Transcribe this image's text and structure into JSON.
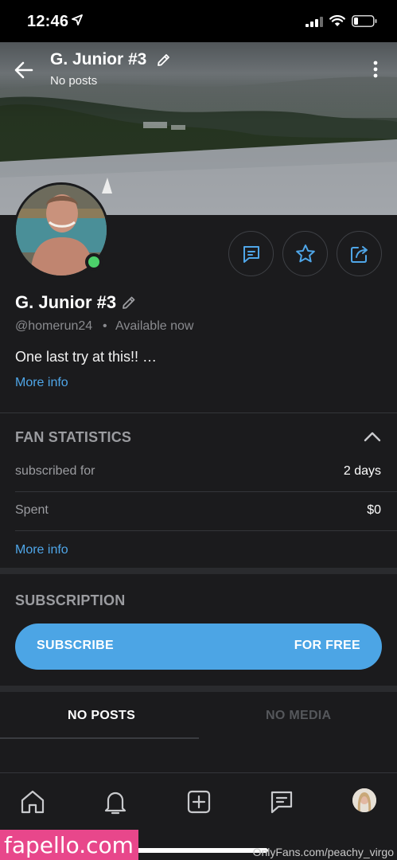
{
  "status_bar": {
    "time": "12:46",
    "icons": [
      "location-arrow-icon",
      "cellular-signal-icon",
      "wifi-icon",
      "battery-icon"
    ]
  },
  "header": {
    "title": "G. Junior #3",
    "subtitle": "No posts",
    "icons": [
      "back-arrow-icon",
      "edit-pencil-icon",
      "kebab-menu-icon"
    ]
  },
  "profile": {
    "name": "G. Junior #3",
    "handle": "@homerun24",
    "separator": "•",
    "availability": "Available now",
    "bio": "One last try at this!! …",
    "more_info": "More info",
    "status_color": "#4cd06a",
    "actions": [
      {
        "icon": "message-icon"
      },
      {
        "icon": "star-icon"
      },
      {
        "icon": "share-icon"
      }
    ]
  },
  "fan_statistics": {
    "title": "FAN STATISTICS",
    "rows": [
      {
        "label": "subscribed for",
        "value": "2 days"
      },
      {
        "label": "Spent",
        "value": "$0"
      }
    ],
    "more_info": "More info"
  },
  "subscription": {
    "title": "SUBSCRIPTION",
    "button_label": "SUBSCRIBE",
    "button_price": "FOR FREE",
    "accent_color": "#4ca5e5"
  },
  "tabs": [
    {
      "label": "NO POSTS",
      "active": true
    },
    {
      "label": "NO MEDIA",
      "active": false
    }
  ],
  "bottom_nav": {
    "items": [
      "home-icon",
      "notifications-bell-icon",
      "add-post-icon",
      "messages-icon",
      "profile-avatar"
    ]
  },
  "watermarks": {
    "left": "fapello.com",
    "right": "OnlyFans.com/peachy_virgo"
  }
}
